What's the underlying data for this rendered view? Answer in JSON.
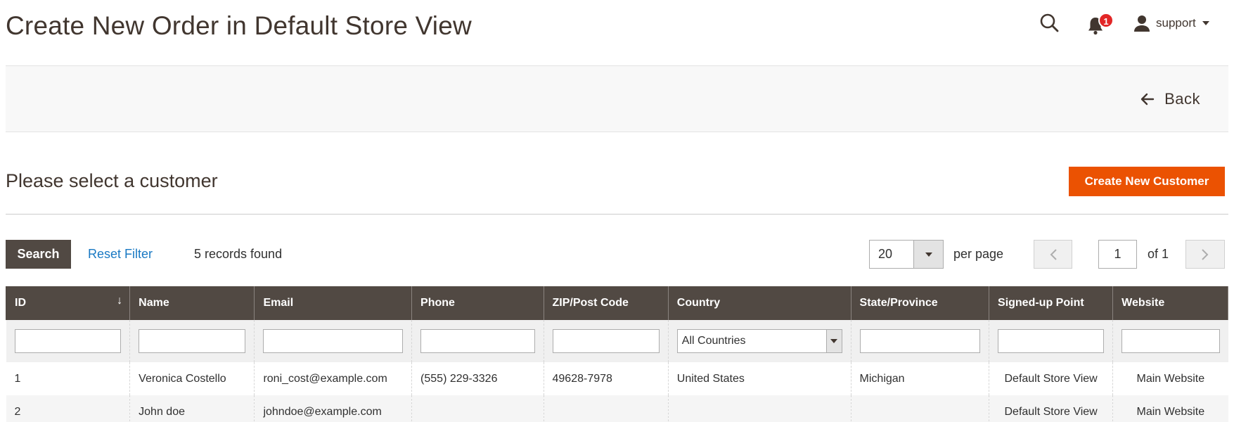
{
  "page_title": "Create New Order in Default Store View",
  "header": {
    "notifications_count": "1",
    "user_name": "support"
  },
  "actions": {
    "back_label": "Back"
  },
  "section": {
    "title": "Please select a customer",
    "create_button": "Create New Customer"
  },
  "toolbar": {
    "search_label": "Search",
    "reset_label": "Reset Filter",
    "records_text": "5 records found",
    "per_page_value": "20",
    "per_page_label": "per page",
    "page_value": "1",
    "of_label": "of 1"
  },
  "grid": {
    "columns": [
      "ID",
      "Name",
      "Email",
      "Phone",
      "ZIP/Post Code",
      "Country",
      "State/Province",
      "Signed-up Point",
      "Website"
    ],
    "country_filter": "All Countries",
    "rows": [
      [
        "1",
        "Veronica Costello",
        "roni_cost@example.com",
        "(555) 229-3326",
        "49628-7978",
        "United States",
        "Michigan",
        "Default Store View",
        "Main Website"
      ],
      [
        "2",
        "John doe",
        "johndoe@example.com",
        "",
        "",
        "",
        "",
        "Default Store View",
        "Main Website"
      ]
    ]
  },
  "colors": {
    "accent": "#eb5202",
    "header_bg": "#514943",
    "link": "#1979c3",
    "badge": "#e22626"
  }
}
